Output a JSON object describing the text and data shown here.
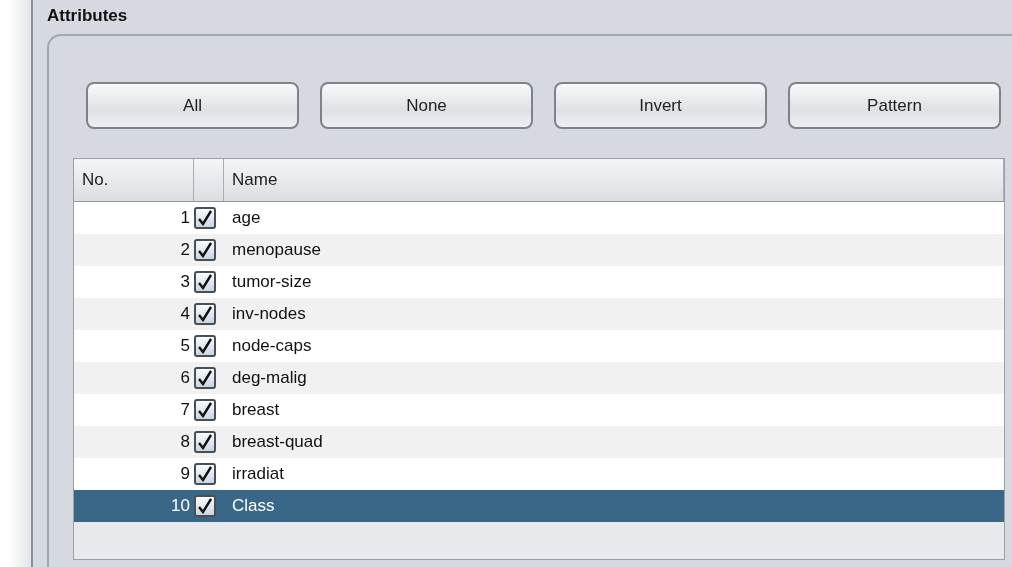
{
  "panel": {
    "title": "Attributes"
  },
  "buttons": [
    "All",
    "None",
    "Invert",
    "Pattern"
  ],
  "table": {
    "columns": [
      "No.",
      "",
      "Name"
    ],
    "rows": [
      {
        "number": "1",
        "checked": true,
        "name": "age",
        "selected": false
      },
      {
        "number": "2",
        "checked": true,
        "name": "menopause",
        "selected": false
      },
      {
        "number": "3",
        "checked": true,
        "name": "tumor-size",
        "selected": false
      },
      {
        "number": "4",
        "checked": true,
        "name": "inv-nodes",
        "selected": false
      },
      {
        "number": "5",
        "checked": true,
        "name": "node-caps",
        "selected": false
      },
      {
        "number": "6",
        "checked": true,
        "name": "deg-malig",
        "selected": false
      },
      {
        "number": "7",
        "checked": true,
        "name": "breast",
        "selected": false
      },
      {
        "number": "8",
        "checked": true,
        "name": "breast-quad",
        "selected": false
      },
      {
        "number": "9",
        "checked": true,
        "name": "irradiat",
        "selected": false
      },
      {
        "number": "10",
        "checked": true,
        "name": "Class",
        "selected": true
      }
    ]
  }
}
